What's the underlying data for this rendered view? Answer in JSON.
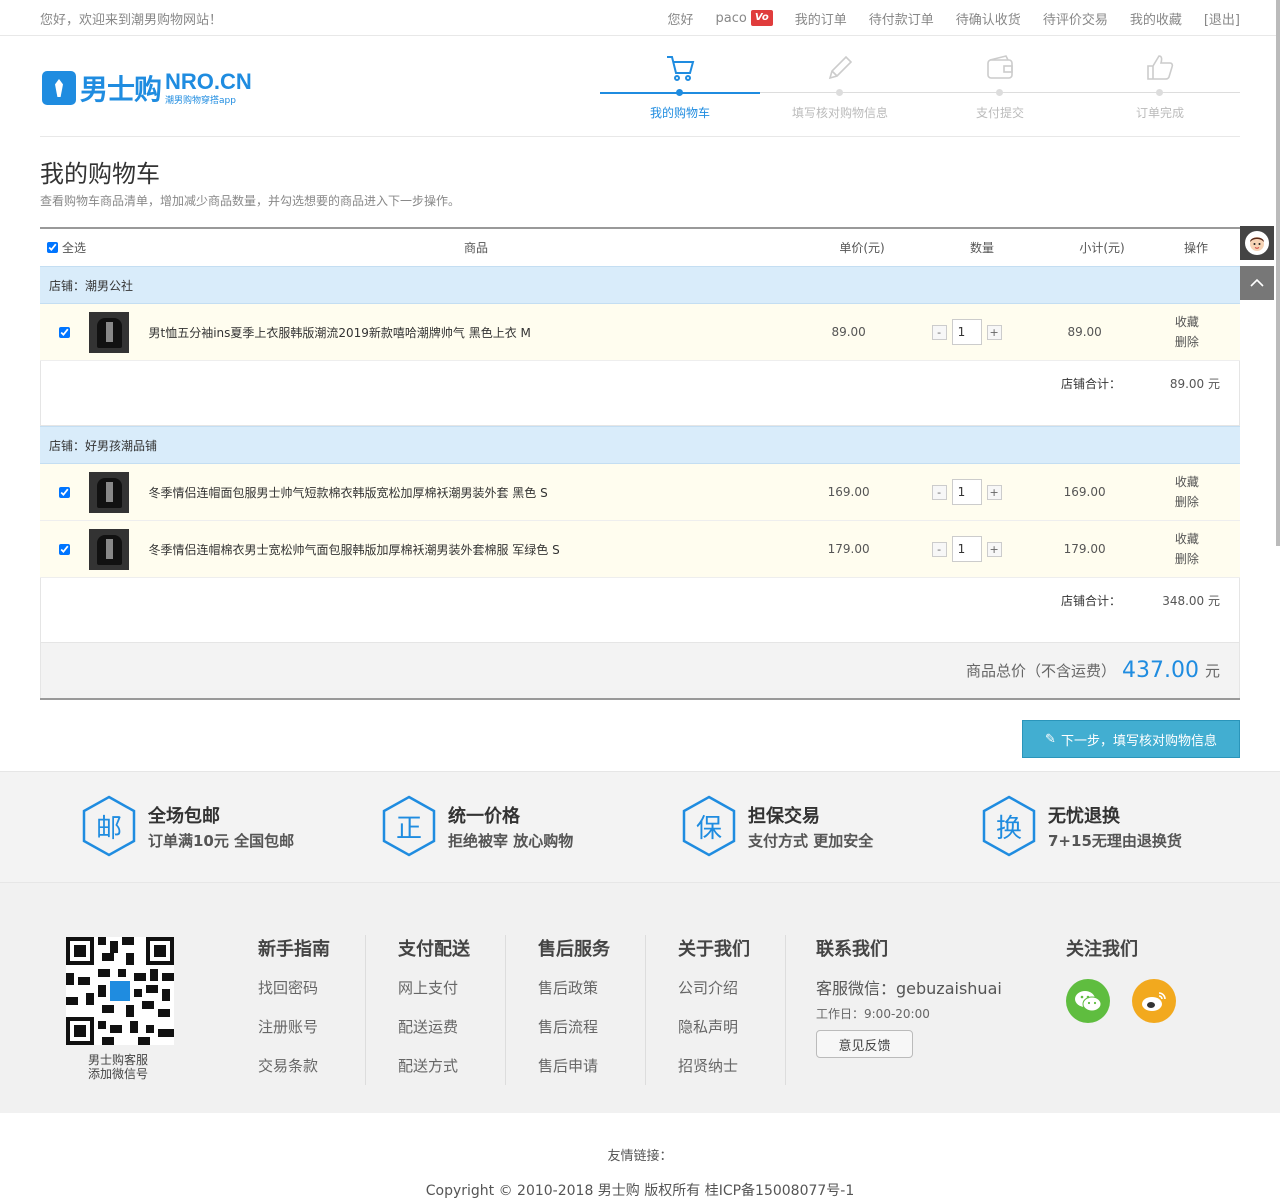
{
  "topbar": {
    "welcome": "您好，欢迎来到潮男购物网站！",
    "greeting": "您好",
    "username": "paco",
    "badge": "Vo",
    "links": [
      "我的订单",
      "待付款订单",
      "待确认收货",
      "待评价交易",
      "我的收藏",
      "[退出]"
    ]
  },
  "logo": {
    "cn": "男士购",
    "en": "NRO.CN",
    "tagline": "潮男购物穿搭app"
  },
  "steps": [
    {
      "label": "我的购物车",
      "active": true,
      "icon": "cart-icon"
    },
    {
      "label": "填写核对购物信息",
      "active": false,
      "icon": "pencil-icon"
    },
    {
      "label": "支付提交",
      "active": false,
      "icon": "wallet-icon"
    },
    {
      "label": "订单完成",
      "active": false,
      "icon": "thumbs-up-icon"
    }
  ],
  "page": {
    "title": "我的购物车",
    "subtitle": "查看购物车商品清单，增加减少商品数量，并勾选想要的商品进入下一步操作。"
  },
  "table": {
    "headers": {
      "select_all": "全选",
      "goods": "商品",
      "price": "单价(元)",
      "qty": "数量",
      "subtotal": "小计(元)",
      "op": "操作"
    },
    "shops": [
      {
        "name": "店铺：潮男公社",
        "items": [
          {
            "title": "男t恤五分袖ins夏季上衣服韩版潮流2019新款嘻哈潮牌帅气 黑色上衣 M",
            "price": "89.00",
            "qty": "1",
            "subtotal": "89.00",
            "fav": "收藏",
            "del": "删除"
          }
        ],
        "sum_label": "店铺合计：",
        "sum": "89.00 元"
      },
      {
        "name": "店铺：好男孩潮品铺",
        "items": [
          {
            "title": "冬季情侣连帽面包服男士帅气短款棉衣韩版宽松加厚棉袄潮男装外套 黑色 S",
            "price": "169.00",
            "qty": "1",
            "subtotal": "169.00",
            "fav": "收藏",
            "del": "删除"
          },
          {
            "title": "冬季情侣连帽棉衣男士宽松帅气面包服韩版加厚棉袄潮男装外套棉服 军绿色 S",
            "price": "179.00",
            "qty": "1",
            "subtotal": "179.00",
            "fav": "收藏",
            "del": "删除"
          }
        ],
        "sum_label": "店铺合计：",
        "sum": "348.00 元"
      }
    ],
    "total_label": "商品总价（不含运费）",
    "total": "437.00",
    "total_unit": "元"
  },
  "next_button": "下一步，填写核对购物信息",
  "guarantees": [
    {
      "char": "邮",
      "title": "全场包邮",
      "desc": "订单满10元  全国包邮"
    },
    {
      "char": "正",
      "title": "统一价格",
      "desc": "拒绝被宰  放心购物"
    },
    {
      "char": "保",
      "title": "担保交易",
      "desc": "支付方式  更加安全"
    },
    {
      "char": "换",
      "title": "无忧退换",
      "desc": "7+15无理由退换货"
    }
  ],
  "footer": {
    "qr_label": [
      "男士购客服",
      "添加微信号"
    ],
    "columns": [
      {
        "title": "新手指南",
        "links": [
          "找回密码",
          "注册账号",
          "交易条款"
        ]
      },
      {
        "title": "支付配送",
        "links": [
          "网上支付",
          "配送运费",
          "配送方式"
        ]
      },
      {
        "title": "售后服务",
        "links": [
          "售后政策",
          "售后流程",
          "售后申请"
        ]
      },
      {
        "title": "关于我们",
        "links": [
          "公司介绍",
          "隐私声明",
          "招贤纳士"
        ]
      }
    ],
    "contact": {
      "title": "联系我们",
      "wechat": "客服微信：gebuzaishuai",
      "hours": "工作日：9:00-20:00",
      "feedback": "意见反馈"
    },
    "follow": {
      "title": "关注我们"
    },
    "friend_links": "友情链接：",
    "copyright": "Copyright © 2010-2018 男士购 版权所有 桂ICP备15008077号-1"
  },
  "colors": {
    "accent": "#1f8ce0",
    "button": "#42aed1",
    "shop_bar": "#d9ecfa",
    "item_bg": "#fffdef",
    "wechat": "#5fbd3f",
    "weibo": "#f2a91e"
  }
}
